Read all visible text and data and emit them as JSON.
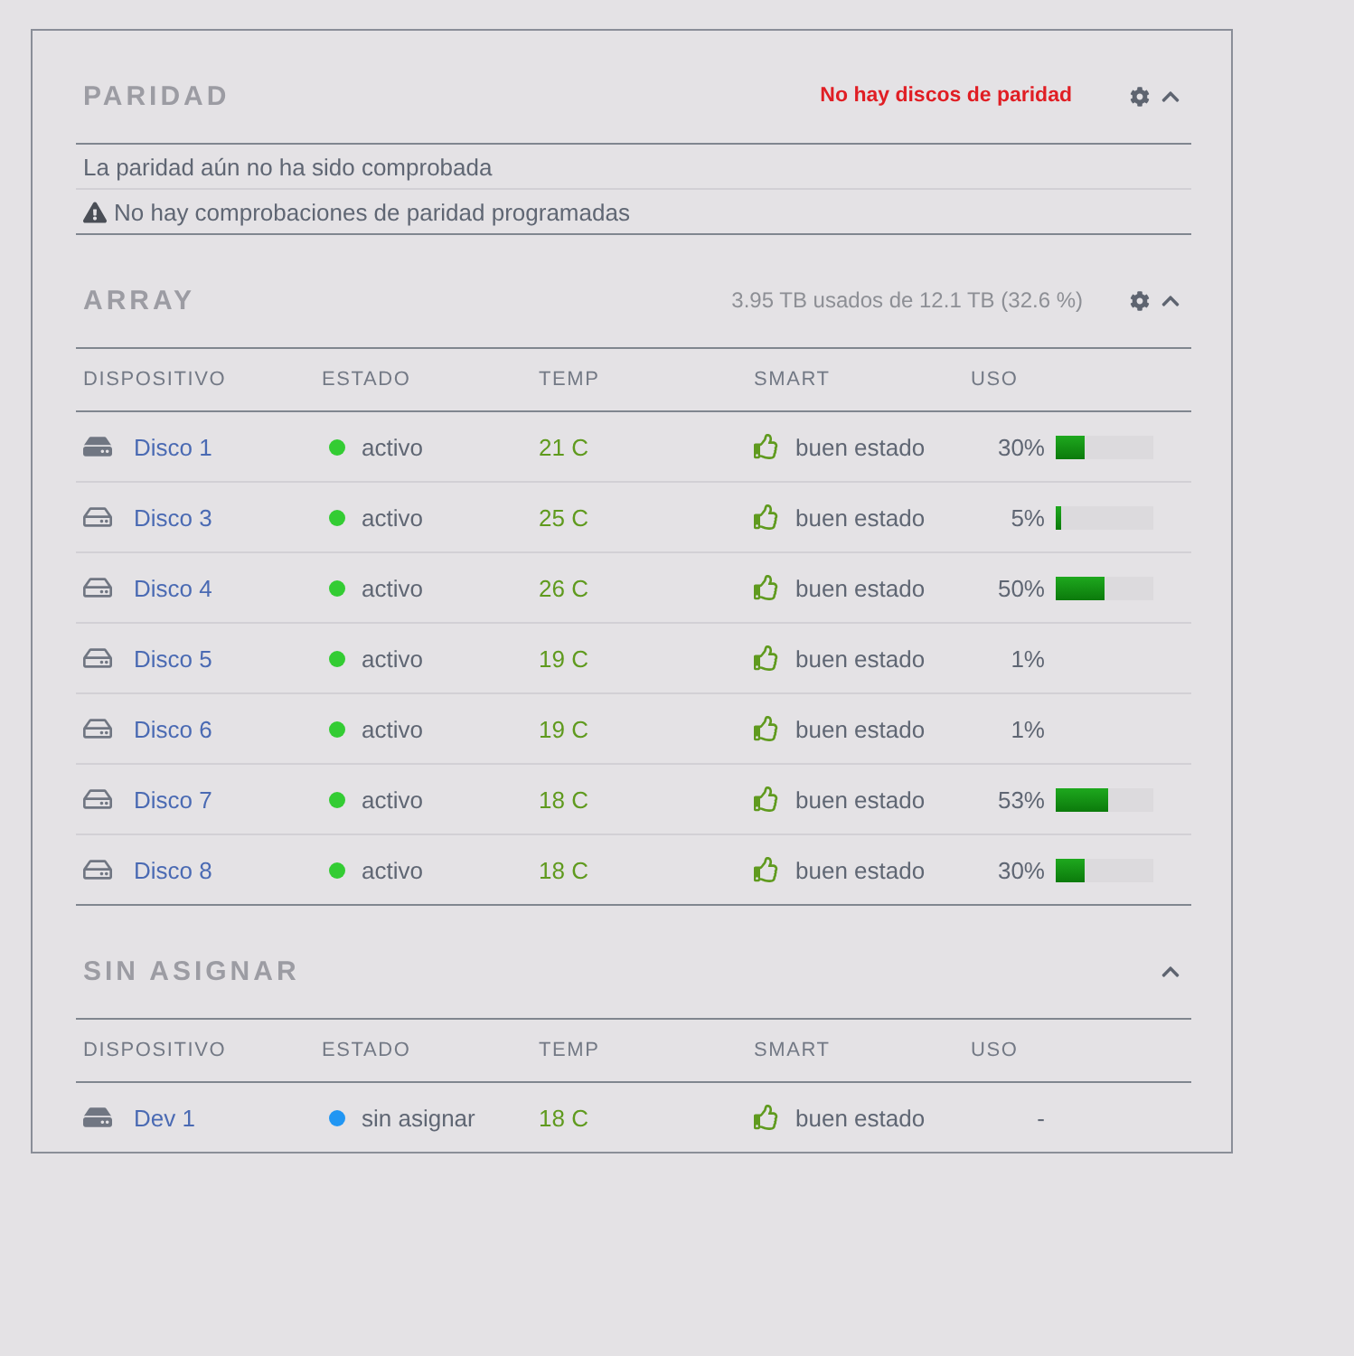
{
  "parity": {
    "title": "PARIDAD",
    "status": "No hay discos de paridad",
    "settings_icon": true,
    "expanded": true,
    "messages": [
      {
        "text": "La paridad aún no ha sido comprobada",
        "warning": false
      },
      {
        "text": "No hay comprobaciones de paridad programadas",
        "warning": true
      }
    ]
  },
  "array": {
    "title": "ARRAY",
    "summary": "3.95 TB usados de 12.1 TB (32.6 %)",
    "settings_icon": true,
    "expanded": true,
    "columns": [
      "DISPOSITIVO",
      "ESTADO",
      "TEMP",
      "SMART",
      "USO"
    ],
    "rows": [
      {
        "kind": "filled",
        "name": "Disco 1",
        "status": "activo",
        "color": "#33cc33",
        "temp": "21 C",
        "smart": "buen estado",
        "usage": "30%",
        "level": 0.3
      },
      {
        "kind": "outline",
        "name": "Disco 3",
        "status": "activo",
        "color": "#33cc33",
        "temp": "25 C",
        "smart": "buen estado",
        "usage": "5%",
        "level": 0.05
      },
      {
        "kind": "outline",
        "name": "Disco 4",
        "status": "activo",
        "color": "#33cc33",
        "temp": "26 C",
        "smart": "buen estado",
        "usage": "50%",
        "level": 0.5
      },
      {
        "kind": "outline",
        "name": "Disco 5",
        "status": "activo",
        "color": "#33cc33",
        "temp": "19 C",
        "smart": "buen estado",
        "usage": "1%"
      },
      {
        "kind": "outline",
        "name": "Disco 6",
        "status": "activo",
        "color": "#33cc33",
        "temp": "19 C",
        "smart": "buen estado",
        "usage": "1%"
      },
      {
        "kind": "outline",
        "name": "Disco 7",
        "status": "activo",
        "color": "#33cc33",
        "temp": "18 C",
        "smart": "buen estado",
        "usage": "53%",
        "level": 0.53
      },
      {
        "kind": "outline",
        "name": "Disco 8",
        "status": "activo",
        "color": "#33cc33",
        "temp": "18 C",
        "smart": "buen estado",
        "usage": "30%",
        "level": 0.3
      }
    ]
  },
  "unassigned": {
    "title": "SIN ASIGNAR",
    "settings_icon": false,
    "expanded": true,
    "columns": [
      "DISPOSITIVO",
      "ESTADO",
      "TEMP",
      "SMART",
      "USO"
    ],
    "rows": [
      {
        "kind": "filled",
        "name": "Dev 1",
        "status": "sin asignar",
        "color": "#2196f3",
        "temp": "18 C",
        "smart": "buen estado",
        "usage": "-"
      }
    ]
  }
}
